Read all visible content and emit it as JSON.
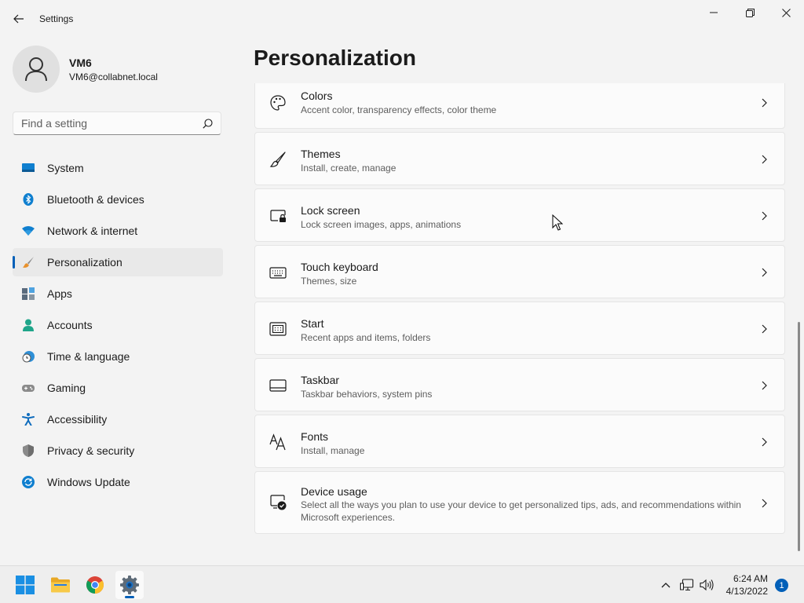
{
  "window": {
    "title": "Settings"
  },
  "user": {
    "name": "VM6",
    "email": "VM6@collabnet.local"
  },
  "search": {
    "placeholder": "Find a setting"
  },
  "nav": {
    "items": [
      {
        "label": "System",
        "icon": "monitor-icon",
        "selected": false
      },
      {
        "label": "Bluetooth & devices",
        "icon": "bluetooth-icon",
        "selected": false
      },
      {
        "label": "Network & internet",
        "icon": "wifi-icon",
        "selected": false
      },
      {
        "label": "Personalization",
        "icon": "paintbrush-icon",
        "selected": true
      },
      {
        "label": "Apps",
        "icon": "apps-icon",
        "selected": false
      },
      {
        "label": "Accounts",
        "icon": "person-icon",
        "selected": false
      },
      {
        "label": "Time & language",
        "icon": "clock-globe-icon",
        "selected": false
      },
      {
        "label": "Gaming",
        "icon": "gamepad-icon",
        "selected": false
      },
      {
        "label": "Accessibility",
        "icon": "accessibility-icon",
        "selected": false
      },
      {
        "label": "Privacy & security",
        "icon": "shield-icon",
        "selected": false
      },
      {
        "label": "Windows Update",
        "icon": "update-icon",
        "selected": false
      }
    ]
  },
  "page": {
    "title": "Personalization",
    "cards": [
      {
        "title": "Colors",
        "subtitle": "Accent color, transparency effects, color theme",
        "icon": "palette-icon"
      },
      {
        "title": "Themes",
        "subtitle": "Install, create, manage",
        "icon": "brush-icon"
      },
      {
        "title": "Lock screen",
        "subtitle": "Lock screen images, apps, animations",
        "icon": "lock-screen-icon"
      },
      {
        "title": "Touch keyboard",
        "subtitle": "Themes, size",
        "icon": "keyboard-icon"
      },
      {
        "title": "Start",
        "subtitle": "Recent apps and items, folders",
        "icon": "start-menu-icon"
      },
      {
        "title": "Taskbar",
        "subtitle": "Taskbar behaviors, system pins",
        "icon": "taskbar-icon"
      },
      {
        "title": "Fonts",
        "subtitle": "Install, manage",
        "icon": "fonts-icon"
      },
      {
        "title": "Device usage",
        "subtitle": "Select all the ways you plan to use your device to get personalized tips, ads, and recommendations within Microsoft experiences.",
        "icon": "device-usage-icon"
      }
    ]
  },
  "taskbar": {
    "apps": [
      "windows-start-icon",
      "file-explorer-icon",
      "chrome-icon",
      "settings-gear-icon"
    ],
    "clock": {
      "time": "6:24 AM",
      "date": "4/13/2022"
    },
    "notification_count": "1"
  },
  "colors": {
    "accent": "#005fb8",
    "background": "#f3f3f3",
    "card": "#fbfbfb"
  }
}
